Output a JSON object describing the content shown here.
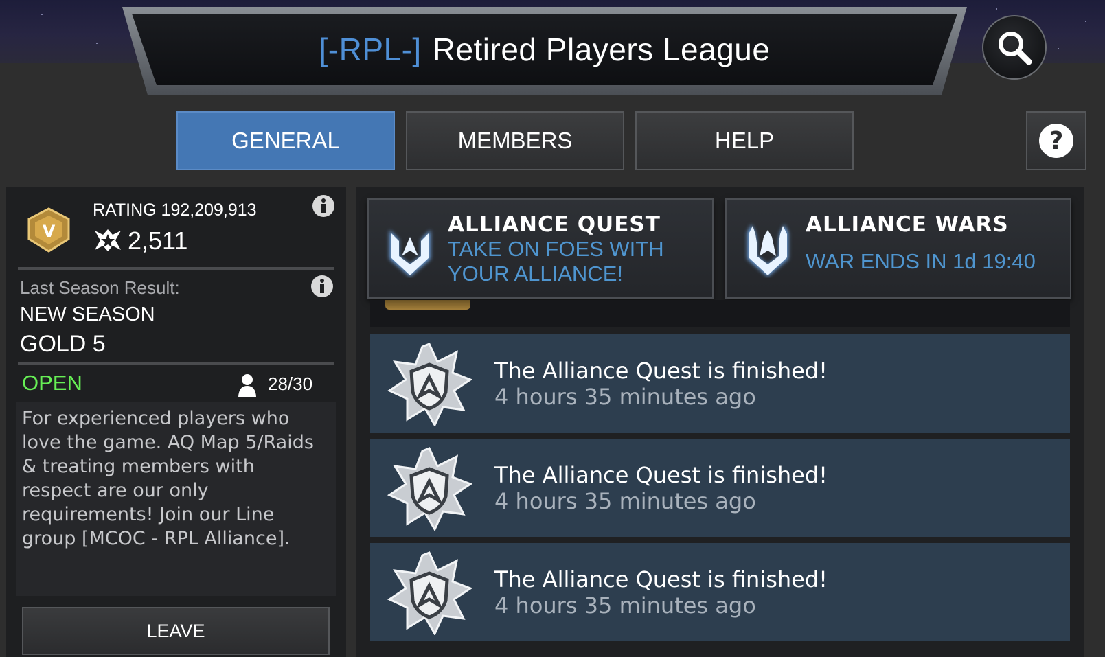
{
  "header": {
    "alliance_tag": "[-RPL-]",
    "alliance_name": "Retired Players League"
  },
  "tabs": [
    {
      "label": "GENERAL",
      "active": true
    },
    {
      "label": "MEMBERS",
      "active": false
    },
    {
      "label": "HELP",
      "active": false
    }
  ],
  "icons": {
    "search": "search-icon",
    "help": "question-mark-icon",
    "info": "info-icon",
    "rank_badge": "rank-badge-icon",
    "trophy": "trophy-icon",
    "member": "member-icon",
    "alliance_quest": "alliance-quest-icon",
    "alliance_wars": "alliance-wars-icon",
    "quest_finished": "quest-finished-icon"
  },
  "colors": {
    "accent_blue": "#4477b4",
    "tag_blue": "#4f8fd6",
    "open_green": "#66ee55",
    "feed_bg": "#2d3e4f"
  },
  "summary": {
    "rating_label": "RATING 192,209,913",
    "badge_letter": "V",
    "trophies": "2,511",
    "last_season_label": "Last Season Result:",
    "last_season_value": "NEW SEASON",
    "tier": "GOLD 5",
    "status": "OPEN",
    "members": "28/30",
    "description": "For experienced players who love the game. AQ Map 5/Raids & treating members with respect are our only requirements! Join our Line group [MCOC - RPL Alliance].",
    "leave_label": "LEAVE"
  },
  "cards": {
    "quest": {
      "title": "ALLIANCE QUEST",
      "subtitle_line1": "TAKE ON FOES WITH",
      "subtitle_line2": "YOUR ALLIANCE!"
    },
    "wars": {
      "title": "ALLIANCE WARS",
      "subtitle": "WAR ENDS IN 1d 19:40"
    }
  },
  "feed": [
    {
      "title": "The Alliance Quest is finished!",
      "time": "4 hours 35 minutes ago"
    },
    {
      "title": "The Alliance Quest is finished!",
      "time": "4 hours 35 minutes ago"
    },
    {
      "title": "The Alliance Quest is finished!",
      "time": "4 hours 35 minutes ago"
    }
  ]
}
